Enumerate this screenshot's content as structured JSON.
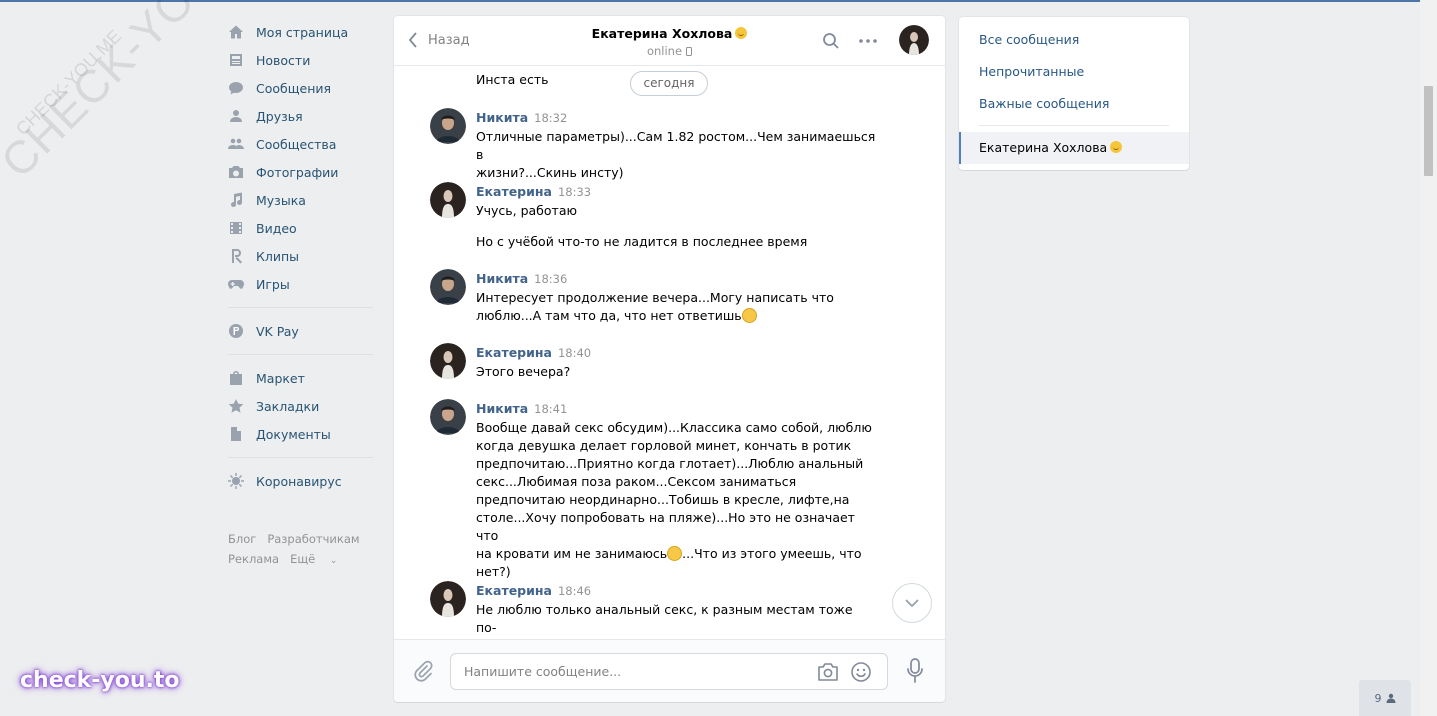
{
  "watermarks": {
    "big": "CHECK-YOU.ME",
    "small": "CHECK-YOU.ME",
    "brand": "check-you.to"
  },
  "nav": {
    "items": [
      {
        "label": "Моя страница",
        "icon": "home-icon"
      },
      {
        "label": "Новости",
        "icon": "news-icon"
      },
      {
        "label": "Сообщения",
        "icon": "messages-icon"
      },
      {
        "label": "Друзья",
        "icon": "friends-icon"
      },
      {
        "label": "Сообщества",
        "icon": "groups-icon"
      },
      {
        "label": "Фотографии",
        "icon": "camera-icon"
      },
      {
        "label": "Музыка",
        "icon": "music-icon"
      },
      {
        "label": "Видео",
        "icon": "video-icon"
      },
      {
        "label": "Клипы",
        "icon": "clips-icon"
      },
      {
        "label": "Игры",
        "icon": "games-icon"
      }
    ],
    "pay": {
      "label": "VK Pay",
      "icon": "vkpay-icon"
    },
    "items2": [
      {
        "label": "Маркет",
        "icon": "market-icon"
      },
      {
        "label": "Закладки",
        "icon": "star-icon"
      },
      {
        "label": "Документы",
        "icon": "document-icon"
      }
    ],
    "corona": {
      "label": "Коронавирус",
      "icon": "virus-icon"
    },
    "footer": {
      "blog": "Блог",
      "dev": "Разработчикам",
      "ads": "Реклама",
      "more": "Ещё"
    }
  },
  "chat": {
    "back_label": "Назад",
    "title": "Екатерина Хохлова",
    "status": "online",
    "date_pill": "сегодня",
    "first_line": "Инста есть",
    "messages": [
      {
        "author": "Никита",
        "time": "18:32",
        "text": "Отличные параметры)...Сам 1.82 ростом...Чем занимаешься в\nжизни?...Скинь инсту)"
      },
      {
        "author": "Екатерина",
        "time": "18:33",
        "text": "Учусь, работаю",
        "text2": "Но с учёбой что-то не ладится в последнее время"
      },
      {
        "author": "Никита",
        "time": "18:36",
        "text": "Интересует продолжение вечера...Могу написать что\nлюблю...А там что да, что нет ответишь"
      },
      {
        "author": "Екатерина",
        "time": "18:40",
        "text": "Этого вечера?"
      },
      {
        "author": "Никита",
        "time": "18:41",
        "text": "Вообще давай секс обсудим)...Классика само собой, люблю\nкогда девушка делает горловой минет, кончать в ротик\nпредпочитаю...Приятно когда глотает)...Люблю анальный\nсекс...Любимая поза раком...Сексом заниматься\nпредпочитаю неординарно...Тобишь в кресле, лифте,на\nстоле...Хочу попробовать на пляже)...Но это не означает что\nна кровати им не занимаюсь",
        "text_after": "...Что из этого умеешь, что\nнет?)"
      },
      {
        "author": "Екатерина",
        "time": "18:46",
        "text": "Не люблю только анальный секс, к разным местам тоже по-\nразному отношусь, не люблю камеры, сразу предупреждаю"
      }
    ],
    "composer_placeholder": "Напишите сообщение..."
  },
  "filters": {
    "all": "Все сообщения",
    "unread": "Непрочитанные",
    "important": "Важные сообщения",
    "active_dialog": "Екатерина Хохлова"
  },
  "online_count": "9",
  "colors": {
    "accent": "#4a76a8",
    "link": "#2a5885",
    "author": "#42648b",
    "bg": "#edeef0"
  }
}
